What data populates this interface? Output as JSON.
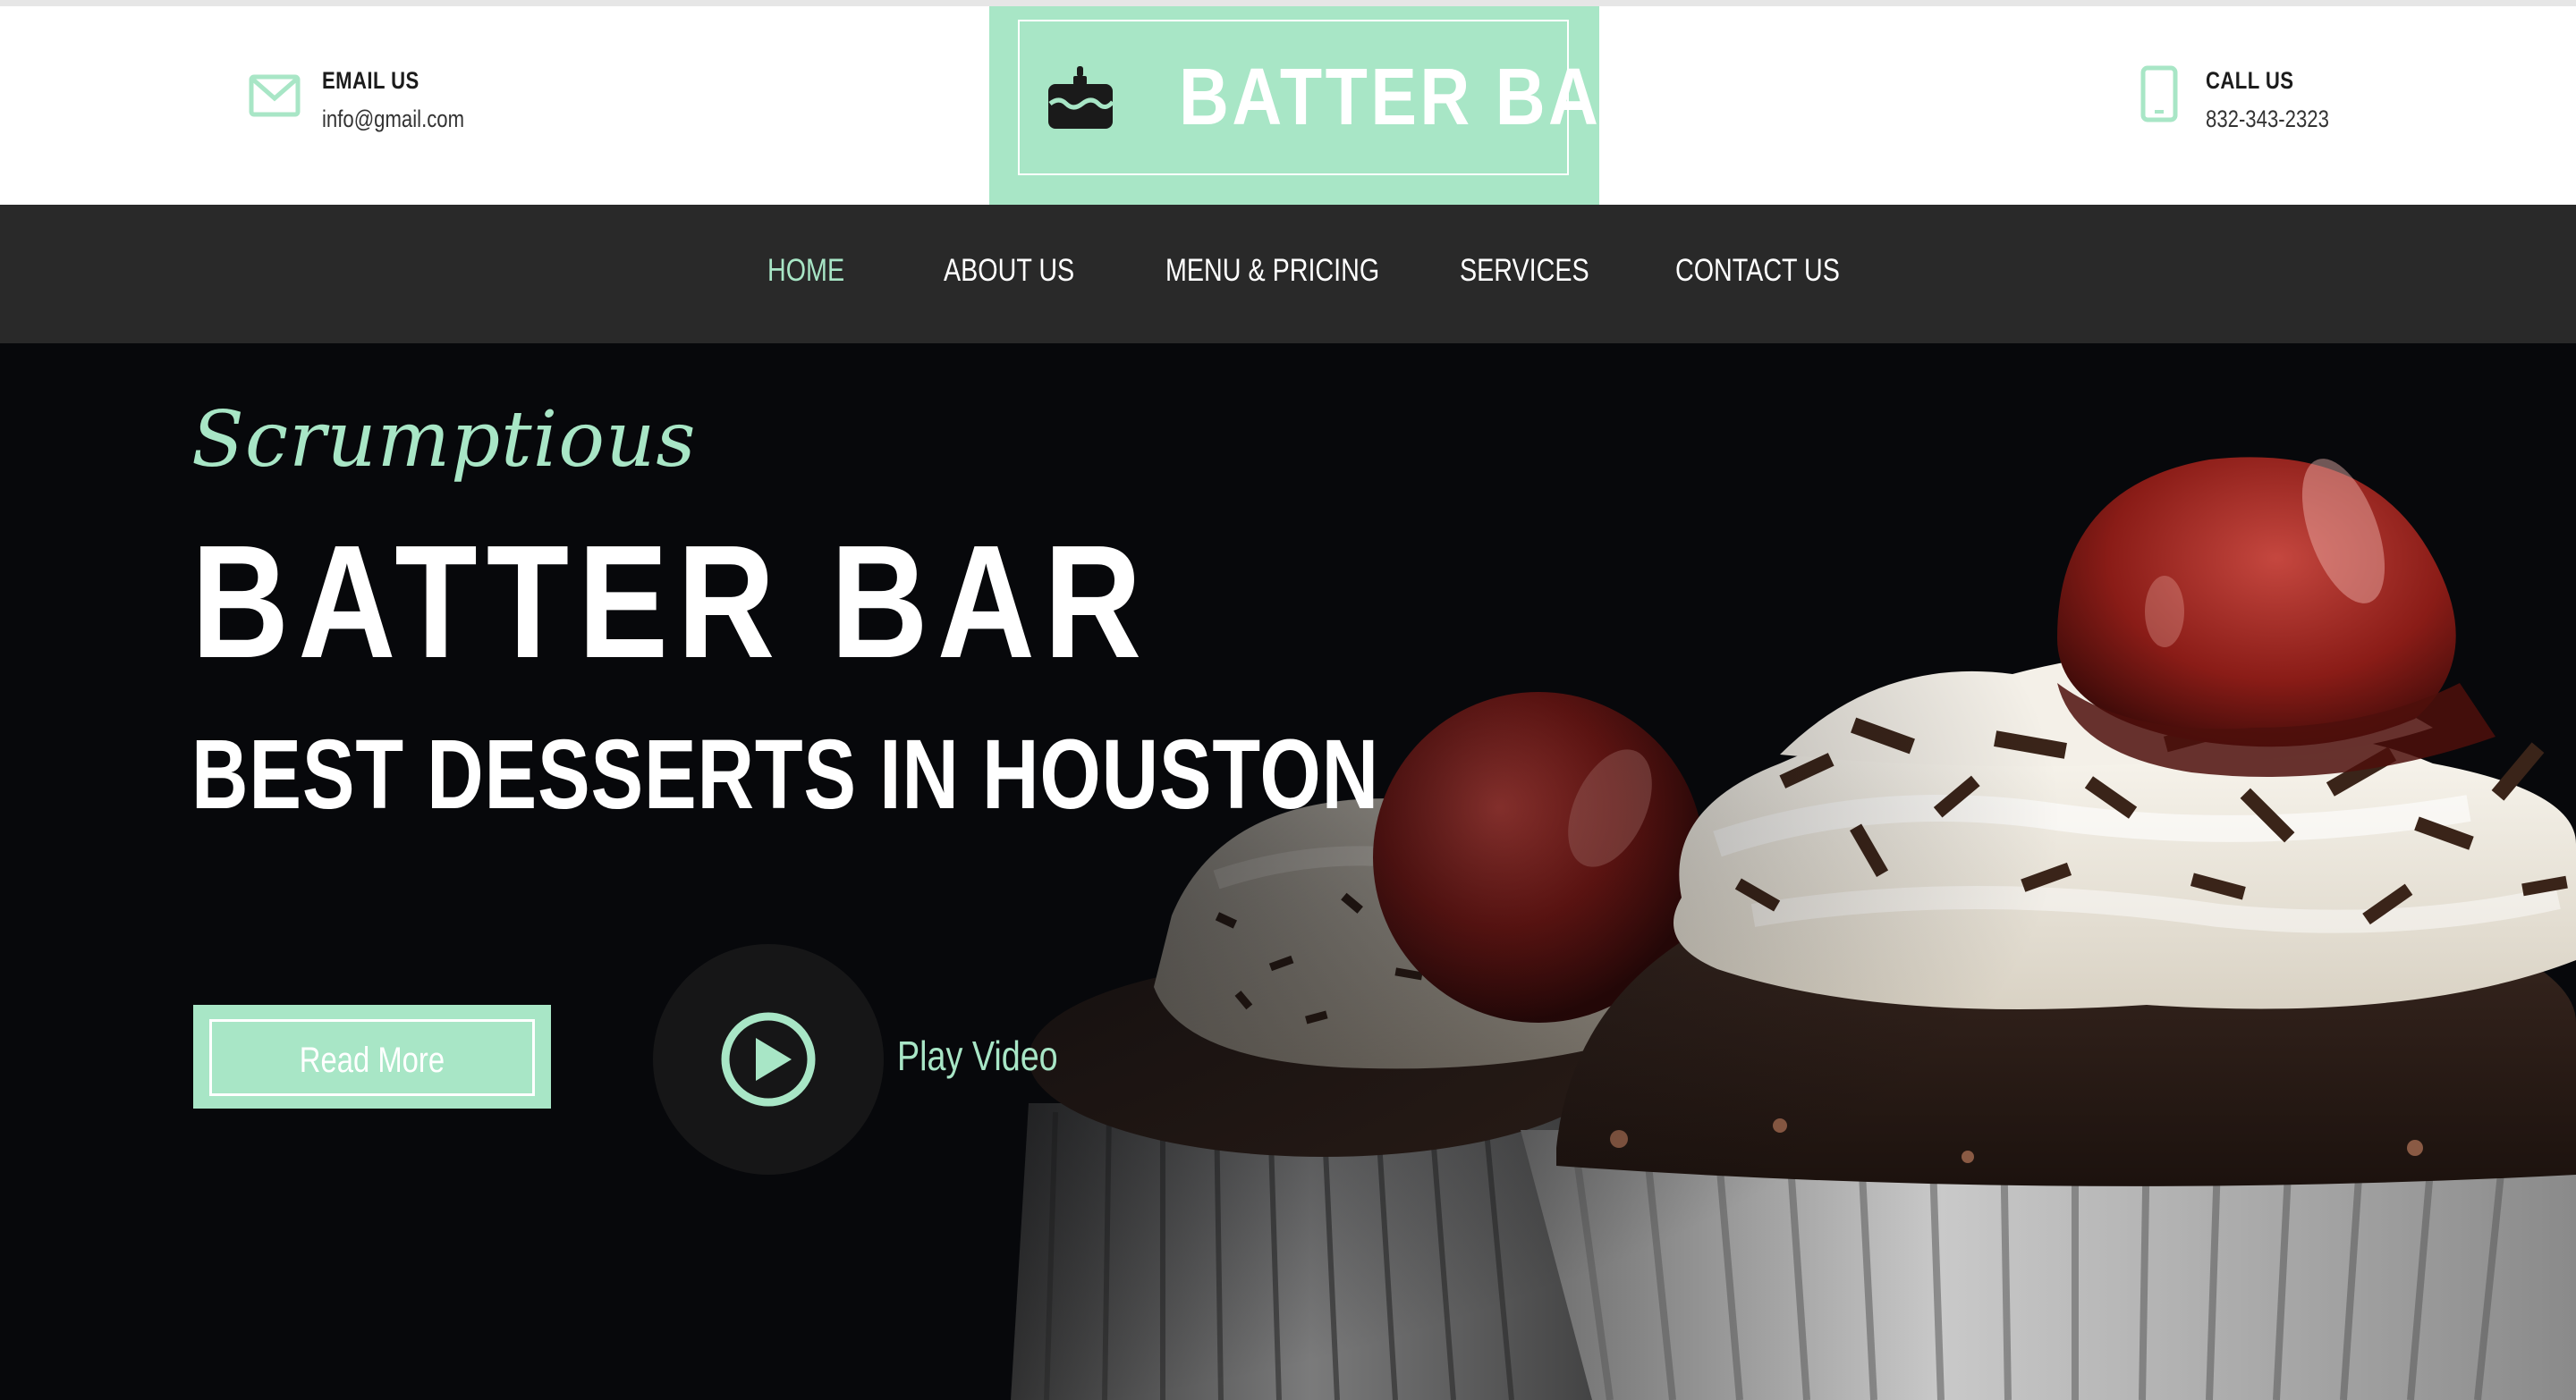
{
  "header": {
    "email": {
      "title": "EMAIL US",
      "value": "info@gmail.com",
      "icon": "envelope-icon"
    },
    "phone": {
      "title": "CALL US",
      "value": "832-343-2323",
      "icon": "mobile-phone-icon"
    },
    "logo": {
      "text": "BATTER BAR",
      "icon": "cake-icon"
    }
  },
  "nav": {
    "items": [
      {
        "label": "HOME",
        "active": true
      },
      {
        "label": "ABOUT US",
        "active": false
      },
      {
        "label": "MENU & PRICING",
        "active": false
      },
      {
        "label": "SERVICES",
        "active": false
      },
      {
        "label": "CONTACT US",
        "active": false
      }
    ]
  },
  "hero": {
    "script": "Scrumptious",
    "title": "BATTER BAR",
    "subtitle": "BEST DESSERTS IN HOUSTON",
    "read_more": "Read More",
    "play_label": "Play Video",
    "play_icon": "play-icon",
    "image": "chocolate-cupcakes-with-cherries-photo"
  },
  "colors": {
    "accent": "#a8e6c6",
    "nav_background": "#292929",
    "hero_background": "#07080b",
    "text_light": "#ffffff"
  }
}
